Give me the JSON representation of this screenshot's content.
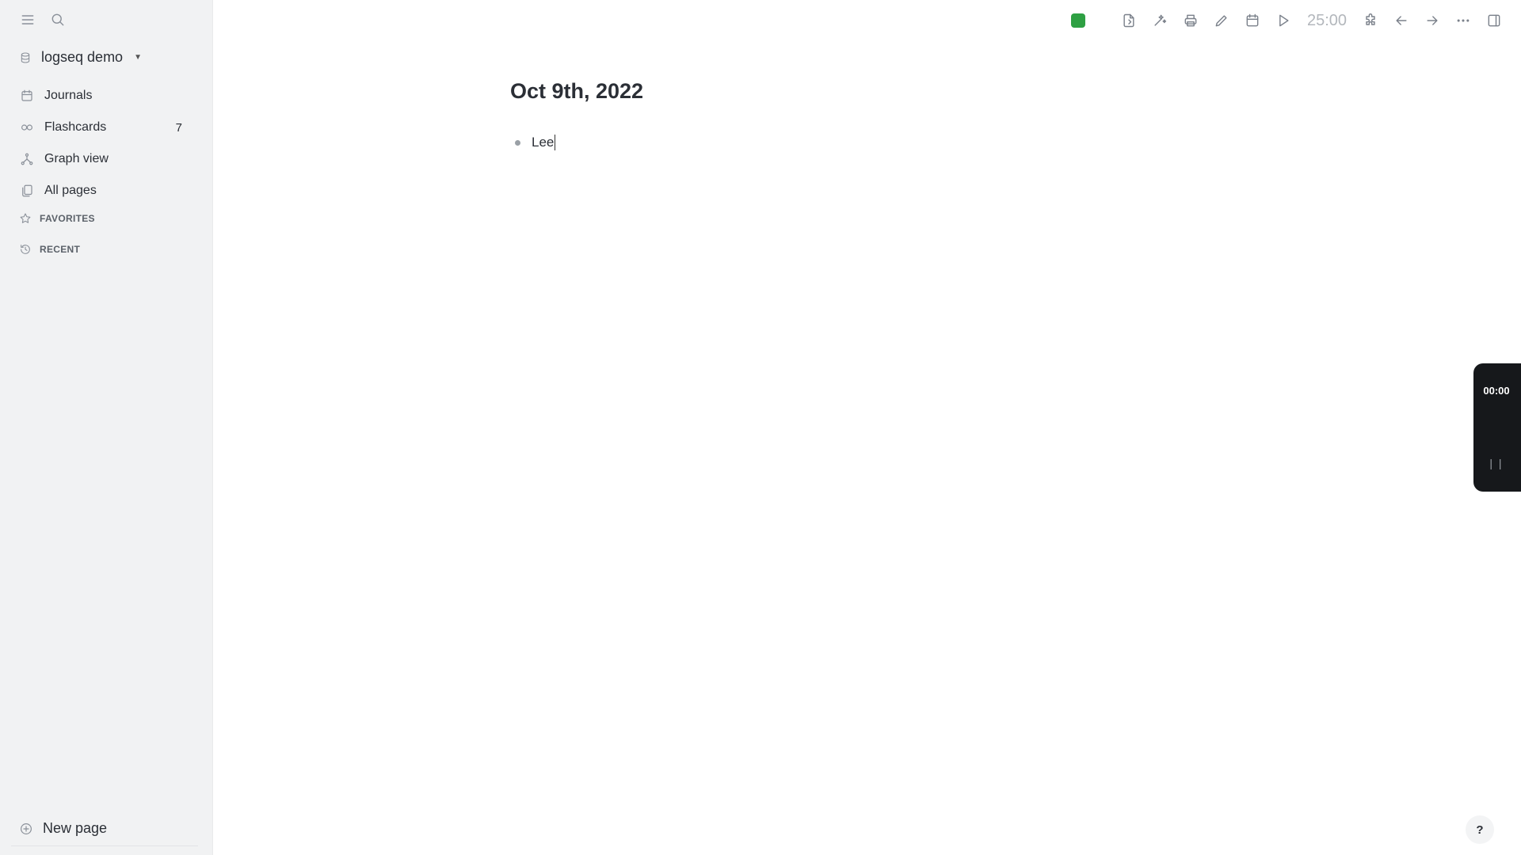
{
  "sidebar": {
    "repo_name": "logseq demo",
    "nav": [
      {
        "label": "Journals",
        "icon": "calendar-icon",
        "count": ""
      },
      {
        "label": "Flashcards",
        "icon": "infinity-icon",
        "count": "7"
      },
      {
        "label": "Graph view",
        "icon": "graph-icon",
        "count": ""
      },
      {
        "label": "All pages",
        "icon": "pages-icon",
        "count": ""
      }
    ],
    "favorites_label": "FAVORITES",
    "recent_label": "RECENT",
    "new_page_label": "New page"
  },
  "toolbar": {
    "sync_color": "#2ea043",
    "timer": "25:00"
  },
  "page": {
    "title": "Oct 9th, 2022",
    "blocks": [
      "Lee"
    ]
  },
  "float_timer": {
    "time": "00:00",
    "pause_glyph": "| |"
  },
  "help_label": "?"
}
